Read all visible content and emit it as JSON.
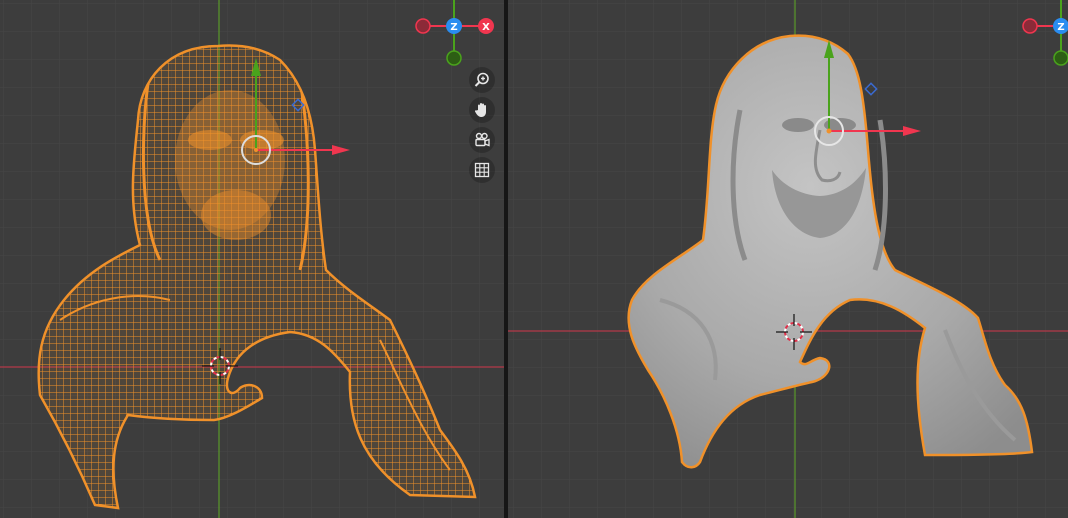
{
  "colors": {
    "background": "#3d3d3d",
    "grid_minor": "#444444",
    "grid_major": "#4a4a4a",
    "x_axis": "#b4384a",
    "y_axis": "#5a9a2a",
    "selection": "#f0912a",
    "mesh_solid": "#a8a8a8",
    "gizmo_x": "#f0364f",
    "gizmo_y": "#4aa31c",
    "gizmo_z": "#2a8df0"
  },
  "left_viewport": {
    "shading": "wireframe",
    "axis_gizmo": {
      "x_label": "X",
      "z_label": "Z"
    },
    "navigation": [
      {
        "icon": "zoom-icon"
      },
      {
        "icon": "pan-hand-icon"
      },
      {
        "icon": "camera-view-icon"
      },
      {
        "icon": "orthographic-grid-icon"
      }
    ]
  },
  "right_viewport": {
    "shading": "solid",
    "axis_gizmo": {
      "z_label": "Z"
    }
  }
}
